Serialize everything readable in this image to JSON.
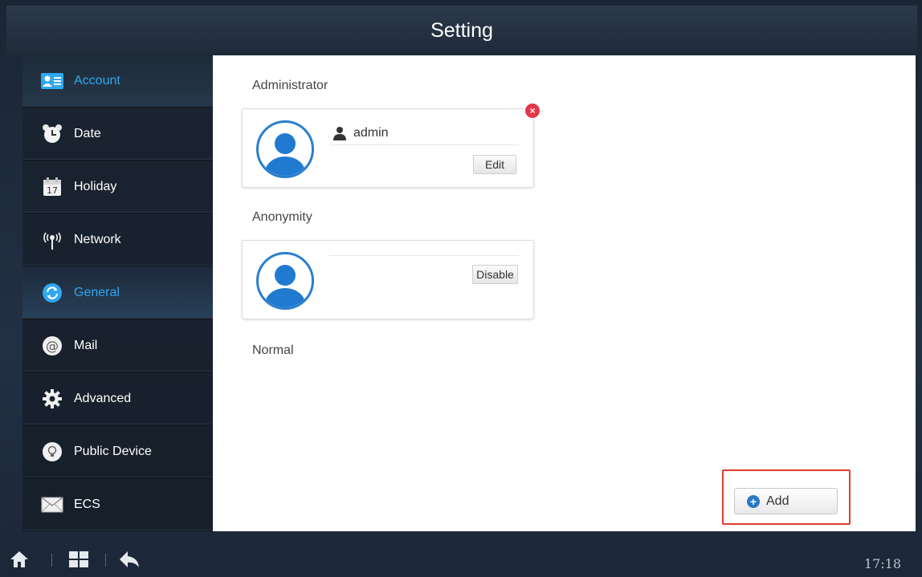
{
  "window": {
    "title": "Setting"
  },
  "sidebar": {
    "items": [
      {
        "label": "Account",
        "icon": "account-card-icon",
        "state": "active"
      },
      {
        "label": "Date",
        "icon": "alarm-clock-icon",
        "state": ""
      },
      {
        "label": "Holiday",
        "icon": "calendar-icon",
        "state": ""
      },
      {
        "label": "Network",
        "icon": "antenna-icon",
        "state": ""
      },
      {
        "label": "General",
        "icon": "refresh-icon",
        "state": "selected"
      },
      {
        "label": "Mail",
        "icon": "at-sign-icon",
        "state": ""
      },
      {
        "label": "Advanced",
        "icon": "gear-icon",
        "state": ""
      },
      {
        "label": "Public Device",
        "icon": "bulb-icon",
        "state": ""
      },
      {
        "label": "ECS",
        "icon": "envelope-icon",
        "state": ""
      }
    ]
  },
  "main": {
    "administrator": {
      "title": "Administrator",
      "user_name": "admin",
      "edit_label": "Edit",
      "remove_symbol": "×"
    },
    "anonymity": {
      "title": "Anonymity",
      "disable_label": "Disable"
    },
    "normal": {
      "title": "Normal"
    },
    "add_label": "Add",
    "add_symbol": "+"
  },
  "status_bar": {
    "time": "17:18"
  },
  "colors": {
    "accent": "#2fa8f0",
    "avatar_blue": "#1f7ad0",
    "highlight_red": "#e23b2e",
    "remove_red": "#e3384c"
  }
}
